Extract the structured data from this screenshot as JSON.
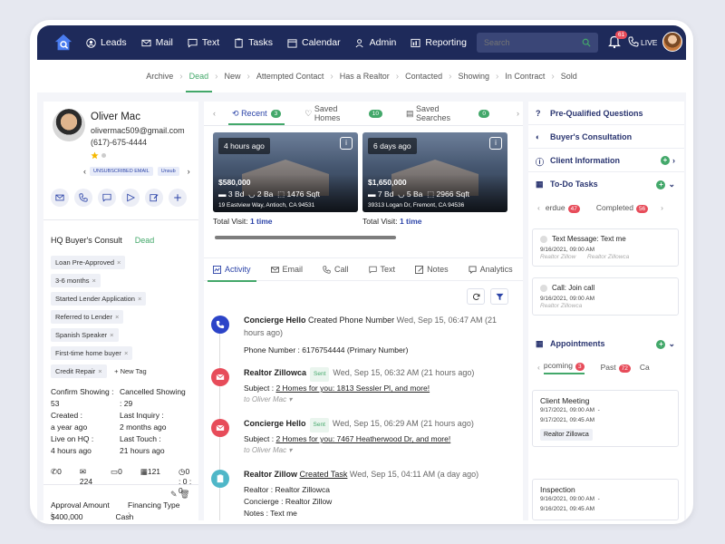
{
  "nav": {
    "items": [
      {
        "label": "Leads",
        "icon": "user-circle-icon"
      },
      {
        "label": "Mail",
        "icon": "mail-icon"
      },
      {
        "label": "Text",
        "icon": "chat-icon"
      },
      {
        "label": "Tasks",
        "icon": "clipboard-icon"
      },
      {
        "label": "Calendar",
        "icon": "calendar-icon"
      },
      {
        "label": "Admin",
        "icon": "admin-icon"
      },
      {
        "label": "Reporting",
        "icon": "reporting-icon"
      }
    ],
    "search_placeholder": "Search",
    "notification_count": "61",
    "live_label": "LIVE"
  },
  "stages": [
    "Archive",
    "Dead",
    "New",
    "Attempted Contact",
    "Has a Realtor",
    "Contacted",
    "Showing",
    "In Contract",
    "Sold"
  ],
  "active_stage": "Dead",
  "lead": {
    "name": "Oliver Mac",
    "email": "olivermac509@gmail.com",
    "phone": "(617)-675-4444",
    "pills": [
      "UNSUBSCRIBED EMAIL",
      "Unsub"
    ],
    "consult_label": "HQ Buyer's Consult",
    "consult_status": "Dead",
    "tags": [
      "Loan Pre-Approved",
      "3-6 months",
      "Started Lender Application",
      "Referred to Lender",
      "Spanish Speaker",
      "First-time home buyer",
      "Credit Repair"
    ],
    "new_tag_label": "New Tag",
    "stats": [
      [
        "Confirm Showing :",
        "Cancelled Showing"
      ],
      [
        "53",
        ": 29"
      ],
      [
        "Created :",
        "Last Inquiry :"
      ],
      [
        "a year ago",
        "2 months ago"
      ],
      [
        "Live on HQ :",
        "Last Touch :"
      ],
      [
        "4 hours ago",
        "21 hours ago"
      ]
    ],
    "counts": [
      "0",
      "224",
      "0",
      "121",
      "0 : 0 : 0"
    ],
    "finance": [
      "Approval Amount :",
      "Financing Type :"
    ],
    "finance_values": [
      "$400,000",
      "Cash"
    ]
  },
  "property_tabs": [
    {
      "label": "Recent",
      "count": "3"
    },
    {
      "label": "Saved Homes",
      "count": "10"
    },
    {
      "label": "Saved Searches",
      "count": "0"
    }
  ],
  "properties": [
    {
      "age": "4 hours ago",
      "price": "$580,000",
      "beds": "3 Bd",
      "baths": "2 Ba",
      "sqft": "1476 Sqft",
      "address": "19 Eastview Way, Antioch, CA 94531",
      "visit_label": "Total Visit:",
      "visit_value": "1 time"
    },
    {
      "age": "6 days ago",
      "price": "$1,650,000",
      "beds": "7 Bd",
      "baths": "5 Ba",
      "sqft": "2966 Sqft",
      "address": "39313 Logan Dr, Fremont, CA 94536",
      "visit_label": "Total Visit:",
      "visit_value": "1 time"
    }
  ],
  "activity_tabs": [
    "Activity",
    "Email",
    "Call",
    "Text",
    "Notes",
    "Analytics"
  ],
  "feed": [
    {
      "who": "Concierge Hello",
      "action": "Created Phone Number",
      "sent": "",
      "time": "Wed, Sep 15, 06:47 AM (21",
      "time2": "hours ago)",
      "line1": "Phone Number : 6176754444 (Primary Number)",
      "line2": "",
      "line3": "",
      "to": ""
    },
    {
      "who": "Realtor Zillowca",
      "action": "",
      "sent": "Sent",
      "time": "Wed, Sep 15, 06:32 AM (21 hours ago)",
      "time2": "",
      "line1": "Subject :",
      "link": "2 Homes for you: 1813 Sessler Pl, and more!",
      "to": "to Oliver Mac"
    },
    {
      "who": "Concierge Hello",
      "action": "",
      "sent": "Sent",
      "time": "Wed, Sep 15, 06:29 AM (21 hours ago)",
      "time2": "",
      "line1": "Subject :",
      "link": "2 Homes for you: 7467 Heatherwood Dr, and more!",
      "to": "to Oliver Mac"
    },
    {
      "who": "Realtor Zillow",
      "action": "Created Task",
      "sent": "",
      "time": "Wed, Sep 15, 04:11 AM (a day ago)",
      "time2": "",
      "line1": "Realtor : Realtor Zillowca",
      "line2": "Concierge : Realtor Zillow",
      "line3": "Notes : Text me",
      "to": ""
    }
  ],
  "right": {
    "rows": [
      "Pre-Qualified Questions",
      "Buyer's Consultation",
      "Client Information",
      "To-Do Tasks"
    ],
    "task_tabs": [
      {
        "label": "erdue",
        "count": "47"
      },
      {
        "label": "Completed",
        "count": "56"
      }
    ],
    "tasks": [
      {
        "title": "Text Message: Text me",
        "date": "9/16/2021, 09:00 AM",
        "from": "Realtor Zillow",
        "to": "Realtor Zillowca"
      },
      {
        "title": "Call: Join call",
        "date": "9/16/2021, 09:00 AM",
        "from": "Realtor Zillowca",
        "to": ""
      }
    ],
    "appointments_label": "Appointments",
    "appt_tabs": [
      {
        "label": "pcoming",
        "count": "3"
      },
      {
        "label": "Past",
        "count": "72"
      },
      {
        "label": "Ca",
        "count": ""
      }
    ],
    "appts": [
      {
        "title": "Client Meeting",
        "from": "9/17/2021, 09:00 AM",
        "to": "9/17/2021, 09:45 AM",
        "agent": "Realtor Zillowca"
      },
      {
        "title": "Inspection",
        "from": "9/16/2021, 09:00 AM",
        "to": "9/16/2021, 09:45 AM",
        "agent": ""
      }
    ]
  },
  "colors": {
    "nav": "#1e2a5a",
    "accent_green": "#43a86a",
    "badge_red": "#e74c5a",
    "link_blue": "#2c44a8"
  }
}
